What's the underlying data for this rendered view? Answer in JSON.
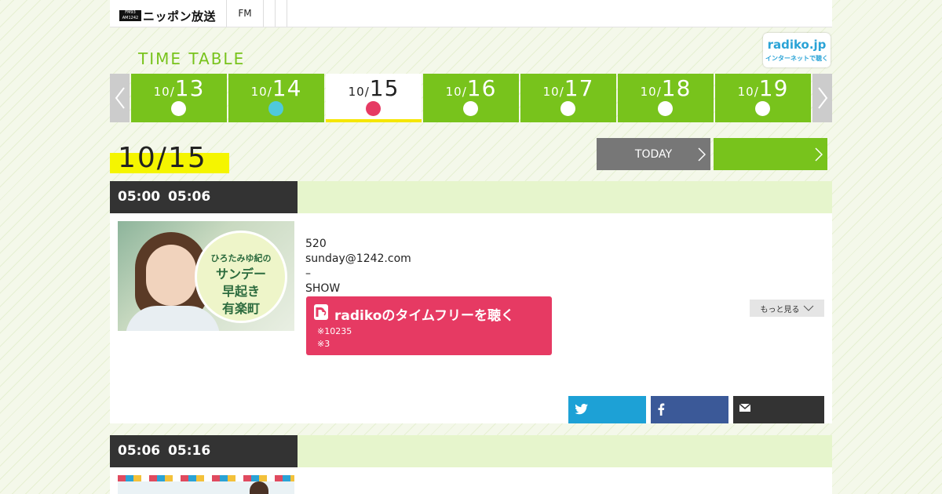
{
  "header": {
    "logo_small": "FM93 AM1242",
    "logo_text": "ニッポン放送",
    "nav": [
      "FM",
      "",
      ""
    ]
  },
  "timetable": {
    "title": "TIME TABLE",
    "radiko_badge": {
      "title": "radiko.jp",
      "subtitle": "インターネットで聴く"
    }
  },
  "dates": [
    {
      "month": "10/",
      "day": "13",
      "dot_color": "#ffffff",
      "current": false
    },
    {
      "month": "10/",
      "day": "14",
      "dot_color": "#4fc9dc",
      "current": false
    },
    {
      "month": "10/",
      "day": "15",
      "dot_color": "#e63a63",
      "current": true
    },
    {
      "month": "10/",
      "day": "16",
      "dot_color": "#ffffff",
      "current": false
    },
    {
      "month": "10/",
      "day": "17",
      "dot_color": "#ffffff",
      "current": false
    },
    {
      "month": "10/",
      "day": "18",
      "dot_color": "#ffffff",
      "current": false
    },
    {
      "month": "10/",
      "day": "19",
      "dot_color": "#ffffff",
      "current": false
    }
  ],
  "current_date": "10/15",
  "buttons": {
    "today": "TODAY",
    "next": ""
  },
  "programs": [
    {
      "time": "05:00  05:06",
      "thumb": {
        "line1": "ひろたみゆ紀の",
        "line2": "サンデー",
        "line3": "早起き",
        "line4": "有楽町"
      },
      "info": [
        "520",
        "sunday@1242.com",
        "–",
        "SHOW"
      ],
      "radiko": {
        "label": "radikoのタイムフリーを聴く",
        "note1": "※10235",
        "note2": "※3"
      },
      "more": "もっと見る"
    },
    {
      "time": "05:06  05:16"
    }
  ],
  "colors": {
    "accent_green": "#78c31c",
    "radiko_pink": "#e63a63",
    "twitter": "#1da1d6",
    "facebook": "#3b5998",
    "highlight_yellow": "#f5f500"
  }
}
